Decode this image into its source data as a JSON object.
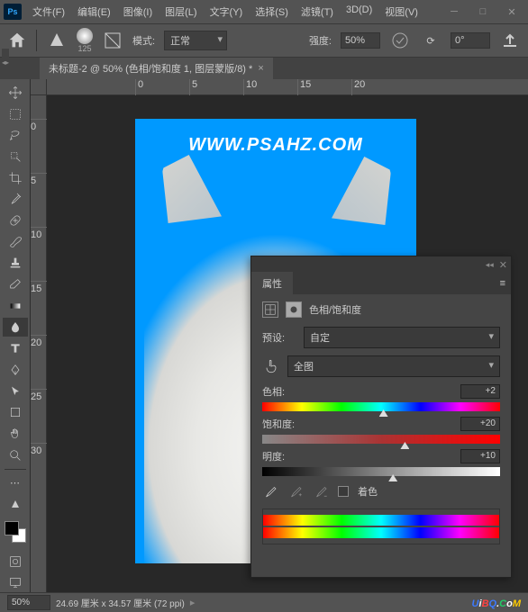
{
  "menu": {
    "file": "文件(F)",
    "edit": "编辑(E)",
    "image": "图像(I)",
    "layer": "图层(L)",
    "type": "文字(Y)",
    "select": "选择(S)",
    "filter": "滤镜(T)",
    "threed": "3D(D)",
    "view": "视图(V)"
  },
  "optbar": {
    "mode_label": "模式:",
    "mode_value": "正常",
    "strength_label": "强度:",
    "strength_value": "50%",
    "angle_value": "0°",
    "brush_size": "125"
  },
  "tab": {
    "title": "未标题-2 @ 50% (色相/饱和度 1, 图层蒙版/8) *"
  },
  "rulers_h": [
    "0",
    "5",
    "10",
    "15",
    "20"
  ],
  "rulers_v": [
    "0",
    "5",
    "10",
    "15",
    "20",
    "25",
    "30"
  ],
  "canvas": {
    "watermark": "WWW.PSAHZ.COM"
  },
  "status": {
    "zoom": "50%",
    "info": "24.69 厘米 x 34.57 厘米 (72 ppi)"
  },
  "panel": {
    "tab": "属性",
    "title": "色相/饱和度",
    "preset_label": "预设:",
    "preset_value": "自定",
    "chan_value": "全图",
    "hue_label": "色相:",
    "hue_value": "+2",
    "sat_label": "饱和度:",
    "sat_value": "+20",
    "lig_label": "明度:",
    "lig_value": "+10",
    "colorize": "着色"
  },
  "site_wm": {
    "u": "U",
    "i": "i",
    "b": "B",
    "q": "Q",
    "dot": ".",
    "c": "C",
    "o": "o",
    "m": "M"
  }
}
